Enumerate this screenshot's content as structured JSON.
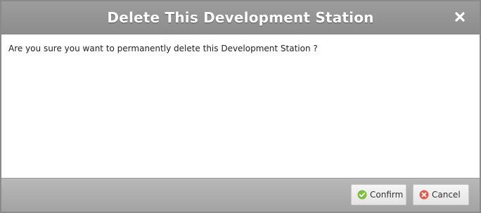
{
  "dialog": {
    "title": "Delete This Development Station",
    "message": "Are you sure you want to permanently delete this Development Station ?",
    "close_icon": "close-icon"
  },
  "buttons": {
    "confirm_label": "Confirm",
    "cancel_label": "Cancel",
    "confirm_icon": "check-circle-icon",
    "cancel_icon": "x-circle-icon"
  },
  "colors": {
    "titlebar": "#959595",
    "footer": "#adadad",
    "confirm_icon": "#7cbf3a",
    "cancel_icon": "#e35b4c"
  }
}
